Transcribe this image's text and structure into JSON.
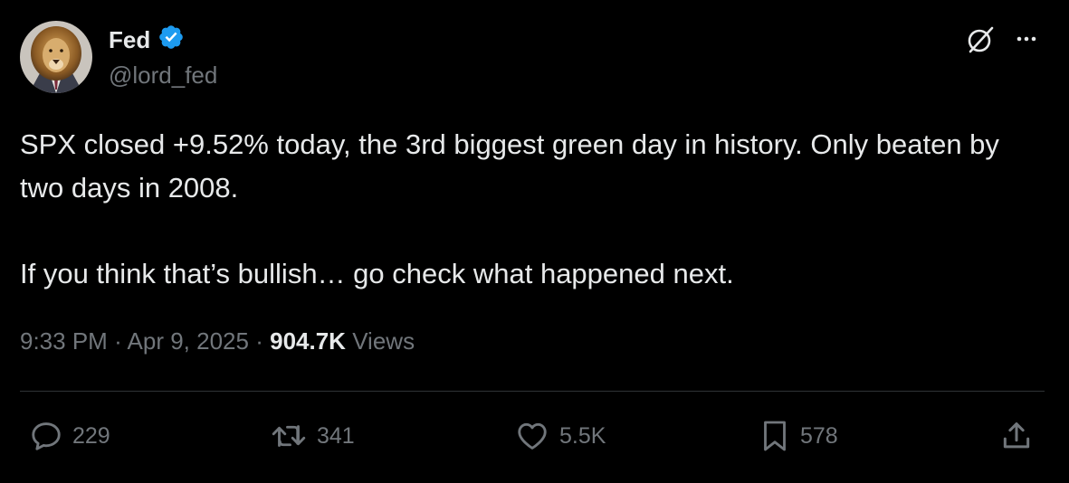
{
  "author": {
    "name": "Fed",
    "handle": "@lord_fed",
    "verified": true,
    "avatar": "lion-in-suit-avatar",
    "verified_color": "#1d9bf0"
  },
  "post": {
    "paragraphs": [
      "SPX closed +9.52% today, the 3rd biggest green day in history. Only beaten by two days in 2008.",
      "If you think that’s bullish… go check what happened next."
    ]
  },
  "meta": {
    "time": "9:33 PM",
    "sep1": "·",
    "date": "Apr 9, 2025",
    "sep2": "·",
    "views_count": "904.7K",
    "views_label": "Views"
  },
  "actions": {
    "replies": {
      "icon": "reply-icon",
      "count": "229"
    },
    "reposts": {
      "icon": "repost-icon",
      "count": "341"
    },
    "likes": {
      "icon": "heart-icon",
      "count": "5.5K"
    },
    "bookmarks": {
      "icon": "bookmark-icon",
      "count": "578"
    },
    "share": {
      "icon": "share-icon"
    }
  },
  "header_icons": [
    "grok-icon",
    "more-icon"
  ],
  "colors": {
    "background": "#000000",
    "text": "#e7e9ea",
    "muted": "#71767b",
    "divider": "#2f3336"
  }
}
